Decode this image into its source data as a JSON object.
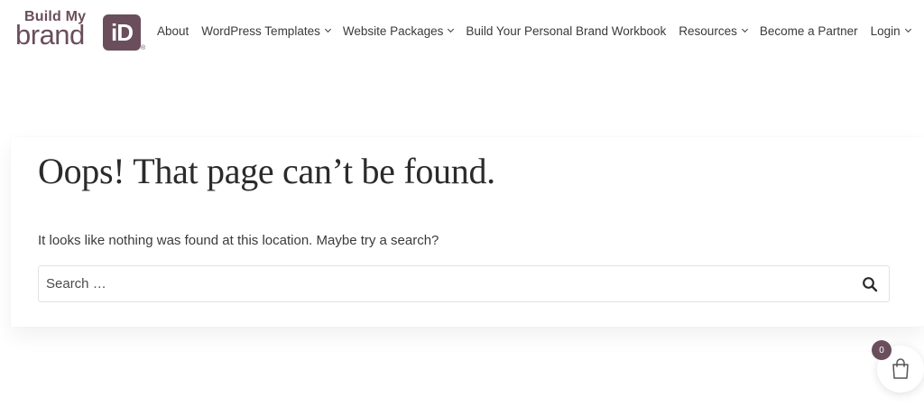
{
  "brand": {
    "line1": "Build My",
    "line2": "brand",
    "badge": "iD",
    "registered": "®",
    "color": "#6a4e5b"
  },
  "nav": {
    "items": [
      {
        "label": "About",
        "has_dropdown": false
      },
      {
        "label": "WordPress Templates",
        "has_dropdown": true
      },
      {
        "label": "Website Packages",
        "has_dropdown": true
      },
      {
        "label": "Build Your Personal Brand Workbook",
        "has_dropdown": false
      },
      {
        "label": "Resources",
        "has_dropdown": true
      },
      {
        "label": "Become a Partner",
        "has_dropdown": false
      },
      {
        "label": "Login",
        "has_dropdown": true
      }
    ]
  },
  "main": {
    "title": "Oops! That page can’t be found.",
    "message": "It looks like nothing was found at this location. Maybe try a search?",
    "search": {
      "placeholder": "Search …",
      "value": "",
      "icon": "search-icon"
    }
  },
  "cart": {
    "count": "0",
    "icon": "shopping-bag-icon"
  }
}
